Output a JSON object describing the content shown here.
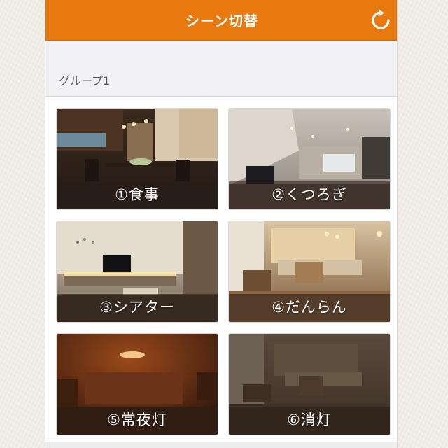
{
  "app": {
    "title": "シーン切替",
    "accent_color": "#e8790f",
    "refresh_icon": "refresh-icon"
  },
  "group": {
    "title": "グループ1"
  },
  "scenes": [
    {
      "label": "①食事"
    },
    {
      "label": "②くつろぎ"
    },
    {
      "label": "③シアター"
    },
    {
      "label": "④だんらん"
    },
    {
      "label": "⑤常夜灯"
    },
    {
      "label": "⑥消灯"
    }
  ]
}
